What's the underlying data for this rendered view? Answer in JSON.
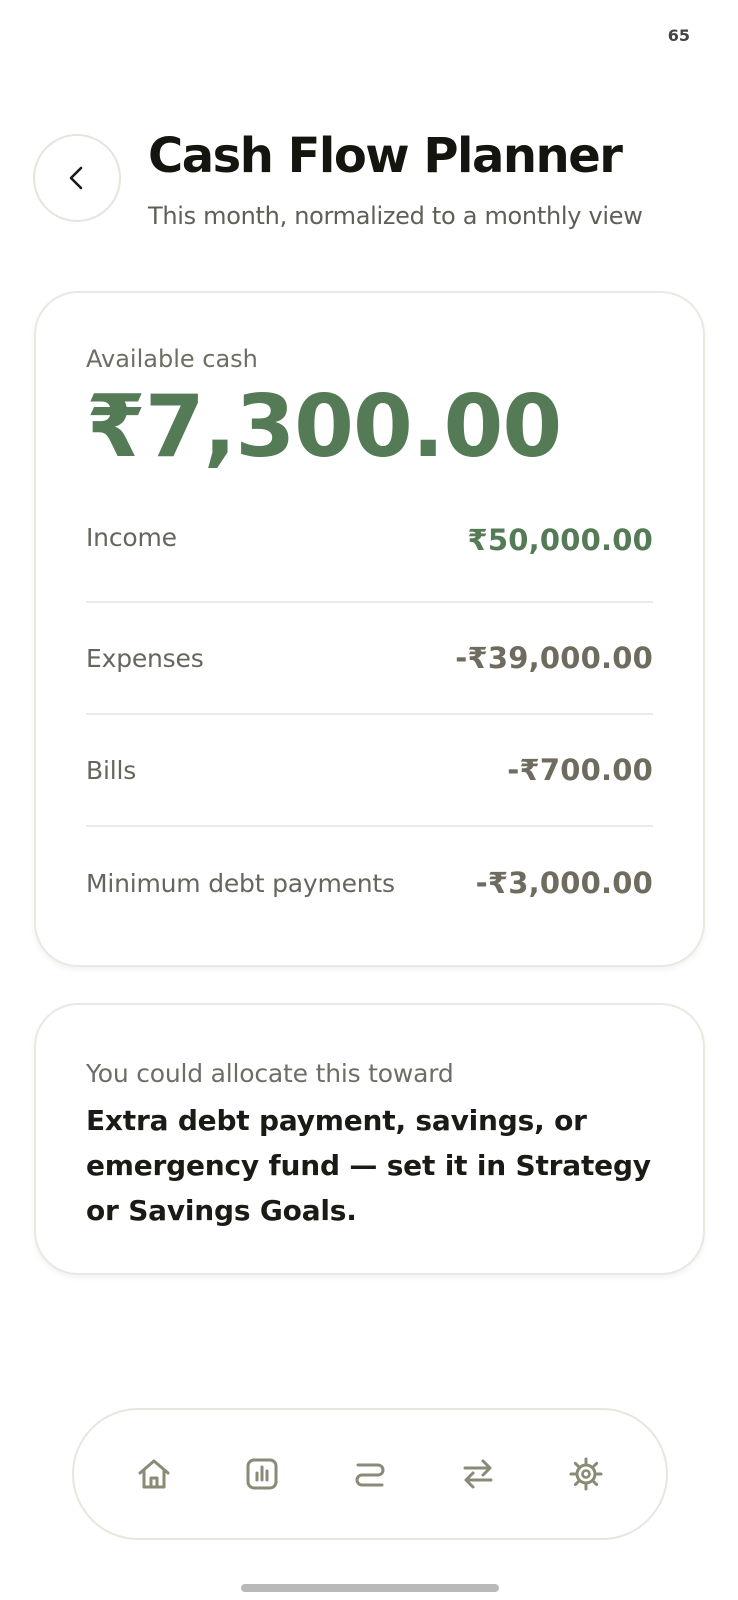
{
  "status": {
    "battery": "65"
  },
  "header": {
    "title": "Cash Flow Planner",
    "subtitle": "This month, normalized to a monthly view"
  },
  "summary": {
    "available_label": "Available cash",
    "available_value": "₹7,300.00",
    "rows": [
      {
        "label": "Income",
        "value": "₹50,000.00"
      },
      {
        "label": "Expenses",
        "value": "-₹39,000.00"
      },
      {
        "label": "Bills",
        "value": "-₹700.00"
      },
      {
        "label": "Minimum debt payments",
        "value": "-₹3,000.00"
      }
    ]
  },
  "hint": {
    "label": "You could allocate this toward",
    "text": "Extra debt payment, savings, or emergency fund — set it in Strategy or Savings Goals."
  },
  "nav": {
    "items": [
      {
        "icon": "home-icon"
      },
      {
        "icon": "chart-icon"
      },
      {
        "icon": "strategy-icon"
      },
      {
        "icon": "transfer-icon"
      },
      {
        "icon": "settings-icon"
      }
    ]
  },
  "colors": {
    "accent_green": "#547a56",
    "negative_value": "#6f6c5f",
    "nav_icon": "#8a8a76"
  }
}
